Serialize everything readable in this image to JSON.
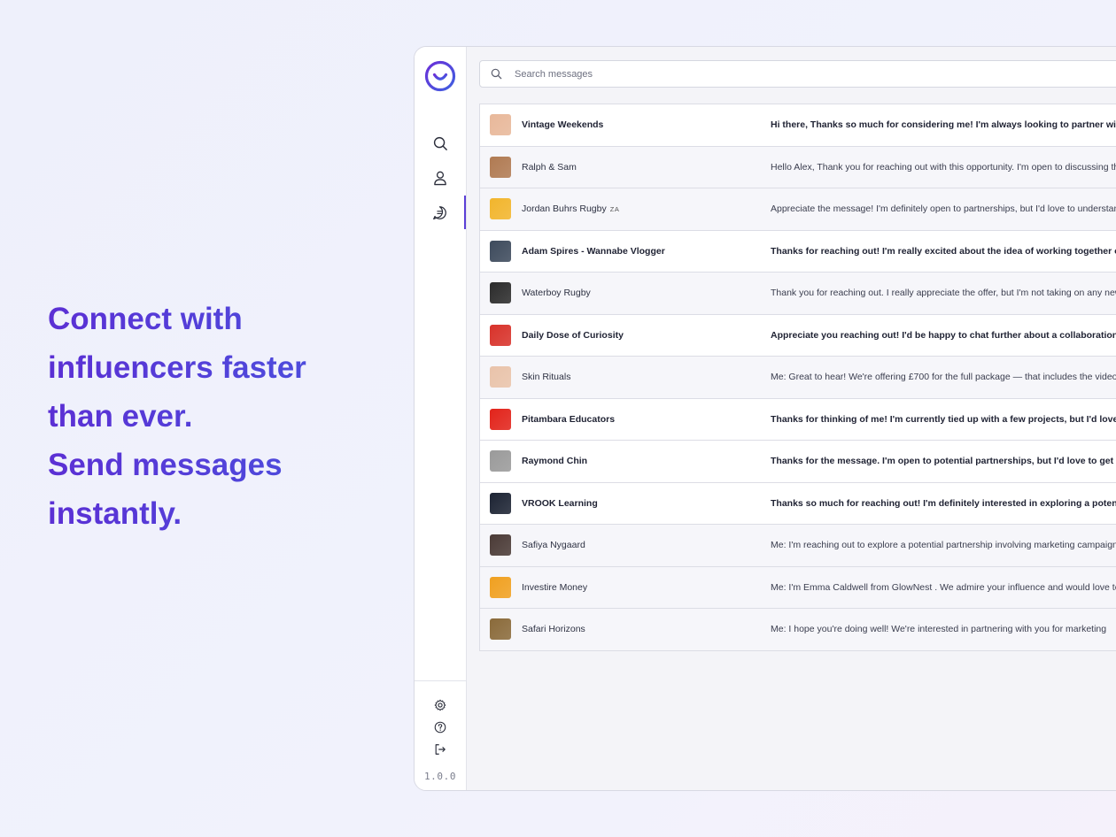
{
  "headline": {
    "line1": "Connect with",
    "line2": "influencers faster",
    "line3": "than ever.",
    "line4": "Send messages",
    "line5": "instantly."
  },
  "app": {
    "version": "1.0.0",
    "accent_color": "#5b3fd6",
    "nav": {
      "top": [
        "search-icon",
        "user-icon",
        "chat-icon"
      ],
      "bottom": [
        "gear-icon",
        "help-icon",
        "logout-icon"
      ]
    },
    "search": {
      "placeholder": "Search messages",
      "value": ""
    },
    "messages": [
      {
        "name": "Vintage Weekends",
        "tag": "",
        "unread": true,
        "avatar_color": "#e8b89a",
        "preview": "Hi there, Thanks so much for considering me! I'm always looking to partner with brands that"
      },
      {
        "name": "Ralph & Sam",
        "tag": "",
        "unread": false,
        "avatar_color": "#b07a52",
        "preview": "Hello Alex, Thank you for reaching out with this opportunity. I'm open to discussing the details"
      },
      {
        "name": "Jordan Buhrs Rugby",
        "tag": "ZA",
        "unread": false,
        "avatar_color": "#f2b52c",
        "preview": "Appreciate the message! I'm definitely open to partnerships, but I'd love to understand more"
      },
      {
        "name": "Adam Spires - Wannabe Vlogger",
        "tag": "",
        "unread": true,
        "avatar_color": "#3d4a5c",
        "preview": "Thanks for reaching out! I'm really excited about the idea of working together on this campaign"
      },
      {
        "name": "Waterboy Rugby",
        "tag": "",
        "unread": false,
        "avatar_color": "#2b2b2b",
        "preview": "Thank you for reaching out. I really appreciate the offer, but I'm not taking on any new"
      },
      {
        "name": "Daily Dose of Curiosity",
        "tag": "",
        "unread": true,
        "avatar_color": "#d8322a",
        "preview": "Appreciate you reaching out! I'd be happy to chat further about a collaboration opportunity"
      },
      {
        "name": "Skin Rituals",
        "tag": "",
        "unread": false,
        "avatar_color": "#e9c3aa",
        "preview": "Me: Great to hear! We're offering £700 for the full package — that includes the video and"
      },
      {
        "name": "Pitambara Educators",
        "tag": "",
        "unread": true,
        "avatar_color": "#e2231a",
        "preview": "Thanks for thinking of me! I'm currently tied up with a few projects, but I'd love to revisit"
      },
      {
        "name": "Raymond Chin",
        "tag": "",
        "unread": true,
        "avatar_color": "#9a9a9a",
        "preview": "Thanks for the message. I'm open to potential partnerships, but I'd love to get more details"
      },
      {
        "name": "VROOK Learning",
        "tag": "",
        "unread": true,
        "avatar_color": "#1c2333",
        "preview": "Thanks so much for reaching out! I'm definitely interested in exploring a potential collaboration"
      },
      {
        "name": "Safiya Nygaard",
        "tag": "",
        "unread": false,
        "avatar_color": "#4a3a36",
        "preview": "Me: I'm reaching out to explore a potential partnership involving marketing campaigns"
      },
      {
        "name": "Investire Money",
        "tag": "",
        "unread": false,
        "avatar_color": "#f0a020",
        "preview": "Me: I'm Emma Caldwell from GlowNest . We admire your influence and would love to connect"
      },
      {
        "name": "Safari Horizons",
        "tag": "",
        "unread": false,
        "avatar_color": "#8a6a3a",
        "preview": "Me: I hope you're doing well! We're interested in partnering with you for marketing"
      }
    ]
  }
}
